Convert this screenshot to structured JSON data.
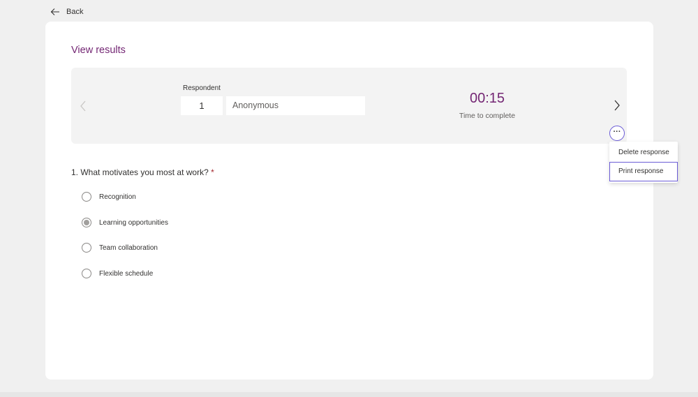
{
  "header": {
    "back_label": "Back"
  },
  "page": {
    "title": "View results"
  },
  "respondent": {
    "label": "Respondent",
    "number": "1",
    "name": "Anonymous"
  },
  "timing": {
    "value": "00:15",
    "label": "Time to complete"
  },
  "menu": {
    "items": [
      {
        "label": "Delete response"
      },
      {
        "label": "Print response"
      }
    ]
  },
  "question": {
    "text": "1. What motivates you most at work?",
    "required_mark": "*",
    "options": [
      {
        "label": "Recognition",
        "selected": false
      },
      {
        "label": "Learning opportunities",
        "selected": true
      },
      {
        "label": "Team collaboration",
        "selected": false
      },
      {
        "label": "Flexible schedule",
        "selected": false
      }
    ]
  },
  "colors": {
    "accent": "#742774",
    "focus": "#6b5cd6",
    "required": "#a4262c"
  },
  "icons": [
    "arrow-left-icon",
    "chevron-left-icon",
    "chevron-right-icon",
    "more-icon"
  ]
}
